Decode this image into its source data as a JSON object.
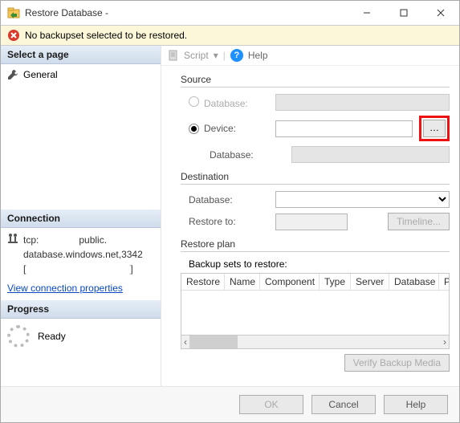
{
  "window": {
    "title": "Restore Database -"
  },
  "banner": {
    "text": "No backupset selected to be restored."
  },
  "left": {
    "select_page_hdr": "Select a page",
    "general": "General",
    "connection_hdr": "Connection",
    "conn_icon": "server-icon",
    "conn_line1": "tcp:               public.",
    "conn_line2": "database.windows.net,3342",
    "conn_line3": "[                                       ]",
    "view_props": "View connection properties",
    "progress_hdr": "Progress",
    "ready": "Ready"
  },
  "toolbar": {
    "script": "Script",
    "help": "Help"
  },
  "source": {
    "label": "Source",
    "database_radio": "Database:",
    "device_radio": "Device:",
    "sub_database": "Database:"
  },
  "destination": {
    "label": "Destination",
    "database": "Database:",
    "restore_to": "Restore to:",
    "timeline_btn": "Timeline..."
  },
  "plan": {
    "label": "Restore plan",
    "backup_sets": "Backup sets to restore:",
    "cols": {
      "restore": "Restore",
      "name": "Name",
      "component": "Component",
      "type": "Type",
      "server": "Server",
      "database": "Database",
      "posit": "Posit"
    },
    "verify_btn": "Verify Backup Media"
  },
  "footer": {
    "ok": "OK",
    "cancel": "Cancel",
    "help": "Help"
  }
}
